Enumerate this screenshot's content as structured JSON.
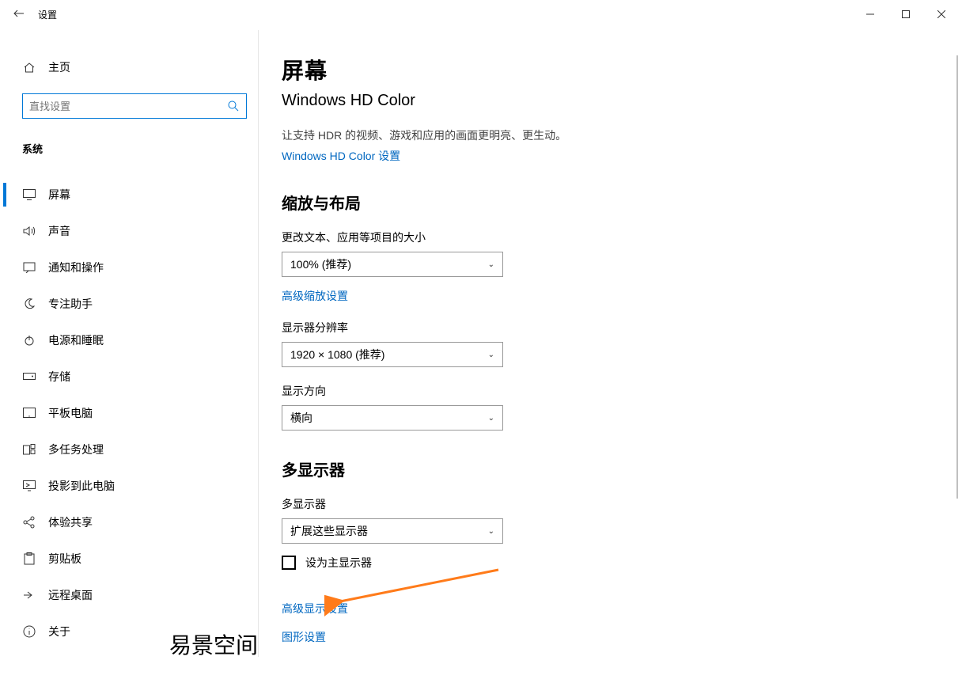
{
  "titlebar": {
    "title": "设置"
  },
  "sidebar": {
    "home_label": "主页",
    "search_placeholder": "直找设置",
    "category": "系统",
    "items": [
      {
        "label": "屏幕"
      },
      {
        "label": "声音"
      },
      {
        "label": "通知和操作"
      },
      {
        "label": "专注助手"
      },
      {
        "label": "电源和睡眠"
      },
      {
        "label": "存储"
      },
      {
        "label": "平板电脑"
      },
      {
        "label": "多任务处理"
      },
      {
        "label": "投影到此电脑"
      },
      {
        "label": "体验共享"
      },
      {
        "label": "剪贴板"
      },
      {
        "label": "远程桌面"
      },
      {
        "label": "关于"
      }
    ]
  },
  "content": {
    "page_title": "屏幕",
    "hdr_heading": "Windows HD Color",
    "hdr_desc": "让支持 HDR 的视频、游戏和应用的画面更明亮、更生动。",
    "hdr_link": "Windows HD Color 设置",
    "scale_heading": "缩放与布局",
    "scale_label": "更改文本、应用等项目的大小",
    "scale_value": "100% (推荐)",
    "scale_adv_link": "高级缩放设置",
    "res_label": "显示器分辨率",
    "res_value": "1920 × 1080 (推荐)",
    "orient_label": "显示方向",
    "orient_value": "横向",
    "multi_heading": "多显示器",
    "multi_label": "多显示器",
    "multi_value": "扩展这些显示器",
    "primary_cb": "设为主显示器",
    "adv_display_link": "高级显示设置",
    "graphics_link": "图形设置"
  },
  "watermark": "易景空间"
}
